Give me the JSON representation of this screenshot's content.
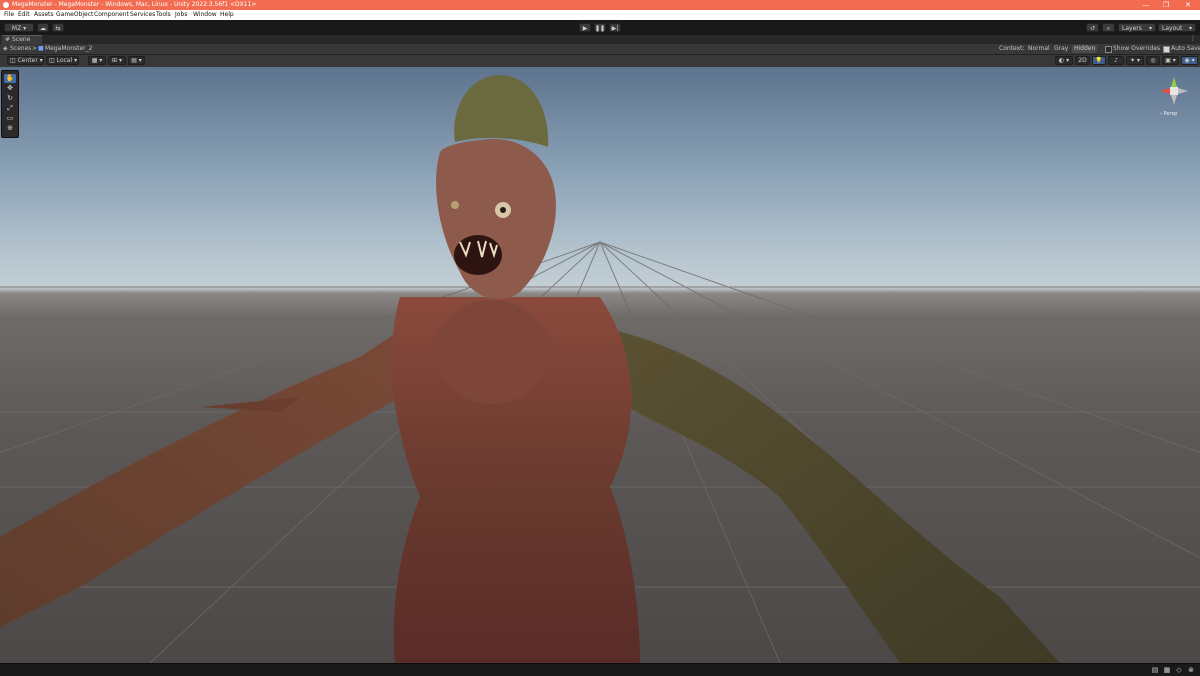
{
  "window": {
    "title": "MegaMonster - MegaMonster - Windows, Mac, Linux - Unity 2022.3.56f1 <DX11>",
    "controls": [
      "—",
      "❐",
      "✕"
    ],
    "accent": "#f16c50"
  },
  "menu": [
    "File",
    "Edit",
    "Assets",
    "GameObject",
    "Component",
    "Services",
    "Tools",
    "Jobs",
    "Window",
    "Help"
  ],
  "toolbar": {
    "account": "MZ",
    "layers_label": "Layers",
    "layout_label": "Layout"
  },
  "scene_tab": {
    "label": "Scene"
  },
  "breadcrumb": {
    "root": "Scenes",
    "separator": ">",
    "current": "MegaMonster_2",
    "context_label": "Context:",
    "context_options": [
      "Normal",
      "Gray",
      "Hidden"
    ],
    "context_selected": "Hidden",
    "show_overrides": "Show Overrides",
    "auto_save": "Auto Save"
  },
  "scene_tools": {
    "pivot": "Center",
    "space": "Local",
    "view_2d": "2D"
  },
  "viewport": {
    "gizmo_label": "‹ Persp",
    "colors": {
      "sky": "#8da3b7",
      "ground": "#5d5958",
      "grid": "#6b6866"
    }
  },
  "tools": [
    "hand-tool",
    "move-tool",
    "rotate-tool",
    "scale-tool",
    "rect-tool",
    "transform-tool"
  ]
}
